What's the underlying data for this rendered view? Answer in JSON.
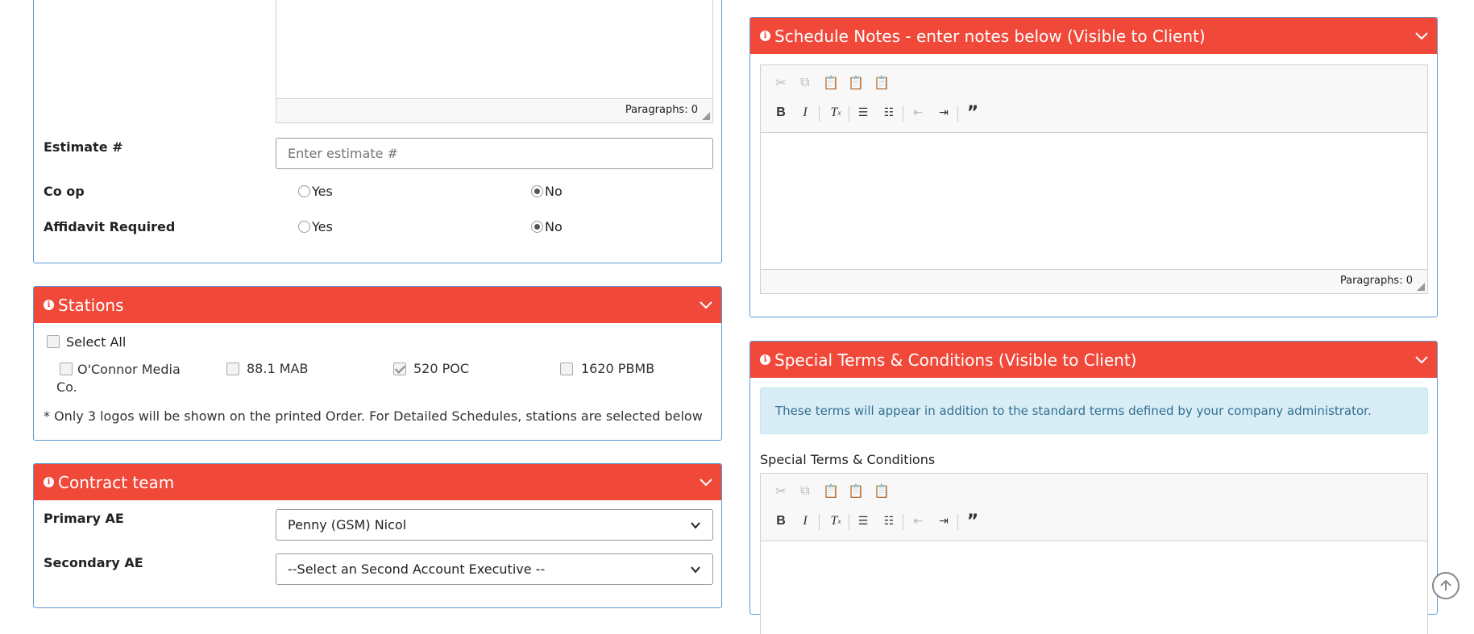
{
  "order_details": {
    "top_editor": {
      "paragraphs_label": "Paragraphs: 0"
    },
    "estimate": {
      "label": "Estimate #",
      "placeholder": "Enter estimate #"
    },
    "co_op": {
      "label": "Co op",
      "yes": "Yes",
      "no": "No",
      "selected": "No"
    },
    "affidavit": {
      "label": "Affidavit Required",
      "yes": "Yes",
      "no": "No",
      "selected": "No"
    }
  },
  "stations": {
    "title": "Stations",
    "select_all": "Select All",
    "items": [
      {
        "label": "O'Connor Media Co.",
        "checked": false
      },
      {
        "label": "88.1 MAB",
        "checked": false
      },
      {
        "label": "520 POC",
        "checked": true
      },
      {
        "label": "1620 PBMB",
        "checked": false
      }
    ],
    "note": "* Only 3 logos will be shown on the printed Order. For Detailed Schedules, stations are selected below"
  },
  "contract_team": {
    "title": "Contract team",
    "primary_ae": {
      "label": "Primary AE",
      "value": "Penny (GSM) Nicol"
    },
    "secondary_ae": {
      "label": "Secondary AE",
      "value": "--Select an Second Account Executive --"
    }
  },
  "schedule_notes": {
    "title": "Schedule Notes - enter notes below (Visible to Client)",
    "paragraphs_label": "Paragraphs: 0"
  },
  "special_terms": {
    "title": "Special Terms & Conditions (Visible to Client)",
    "alert": "These terms will appear in addition to the standard terms defined by your company administrator.",
    "field_label": "Special Terms & Conditions"
  },
  "colors": {
    "header_red": "#f0493a",
    "panel_border": "#5a9bd5",
    "alert_bg": "#d9edf7"
  },
  "icons": [
    "info-icon",
    "chevron-down-icon",
    "cut-icon",
    "copy-icon",
    "paste-icon",
    "paste-text-icon",
    "paste-word-icon",
    "bold-icon",
    "italic-icon",
    "remove-format-icon",
    "numbered-list-icon",
    "bulleted-list-icon",
    "outdent-icon",
    "indent-icon",
    "blockquote-icon",
    "scroll-top-icon"
  ]
}
